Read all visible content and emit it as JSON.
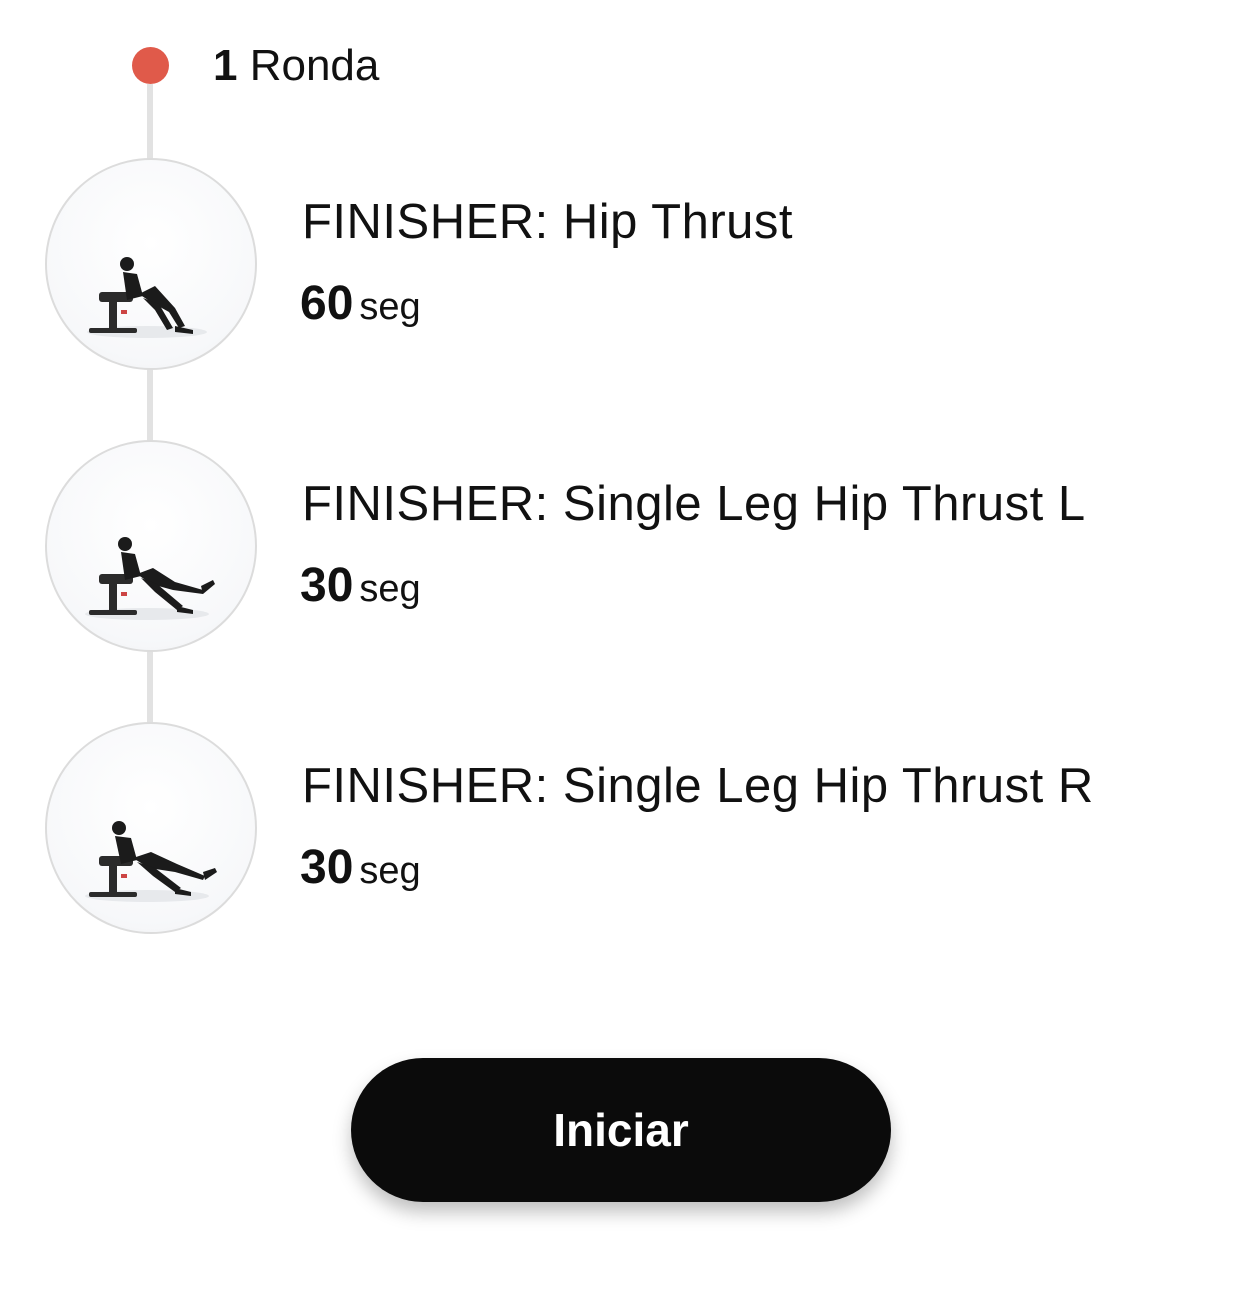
{
  "round": {
    "count": "1",
    "label": "Ronda",
    "dot_color": "#e05a4a"
  },
  "exercises": [
    {
      "name": "FINISHER: Hip Thrust",
      "duration": "60",
      "unit": "seg",
      "image": "hip-thrust-thumbnail"
    },
    {
      "name": "FINISHER: Single Leg Hip Thrust L",
      "duration": "30",
      "unit": "seg",
      "image": "single-leg-hip-thrust-left-thumbnail"
    },
    {
      "name": "FINISHER: Single Leg Hip Thrust R",
      "duration": "30",
      "unit": "seg",
      "image": "single-leg-hip-thrust-right-thumbnail"
    }
  ],
  "start_button": {
    "label": "Iniciar",
    "color": "#0b0b0b"
  }
}
